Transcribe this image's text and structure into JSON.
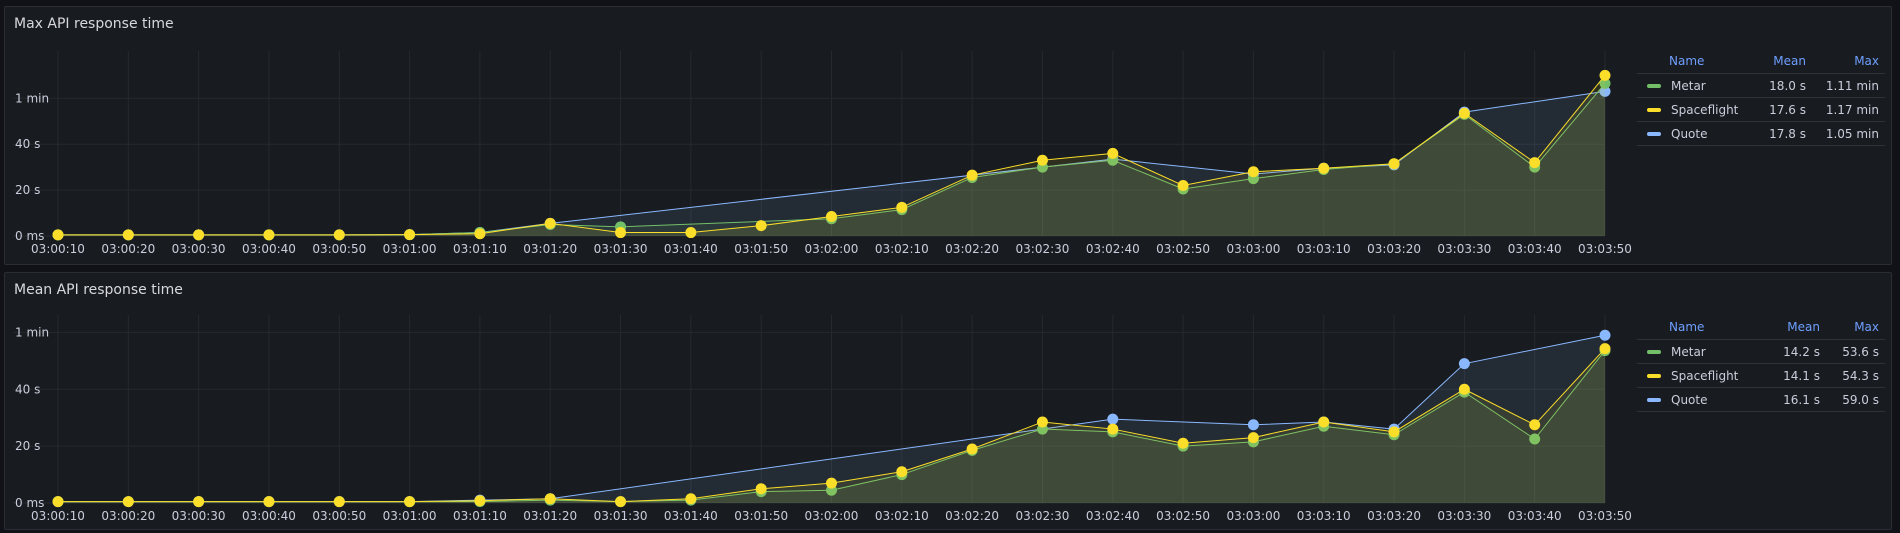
{
  "panels": [
    {
      "title": "Max API response time",
      "legend": {
        "headers": {
          "name": "Name",
          "mean": "Mean",
          "max": "Max"
        },
        "rows": [
          {
            "name": "Metar",
            "mean": "18.0 s",
            "max": "1.11 min",
            "color": "#73bf69"
          },
          {
            "name": "Spaceflight",
            "mean": "17.6 s",
            "max": "1.17 min",
            "color": "#fade2a"
          },
          {
            "name": "Quote",
            "mean": "17.8 s",
            "max": "1.05 min",
            "color": "#8ab8ff"
          }
        ]
      }
    },
    {
      "title": "Mean API response time",
      "legend": {
        "headers": {
          "name": "Name",
          "mean": "Mean",
          "max": "Max"
        },
        "rows": [
          {
            "name": "Metar",
            "mean": "14.2 s",
            "max": "53.6 s",
            "color": "#73bf69"
          },
          {
            "name": "Spaceflight",
            "mean": "14.1 s",
            "max": "54.3 s",
            "color": "#fade2a"
          },
          {
            "name": "Quote",
            "mean": "16.1 s",
            "max": "59.0 s",
            "color": "#8ab8ff"
          }
        ]
      }
    }
  ],
  "chart_data": [
    {
      "type": "line",
      "title": "Max API response time",
      "x_tick_labels": [
        "03:00:10",
        "03:00:20",
        "03:00:30",
        "03:00:40",
        "03:00:50",
        "03:01:00",
        "03:01:10",
        "03:01:20",
        "03:01:30",
        "03:01:40",
        "03:01:50",
        "03:02:00",
        "03:02:10",
        "03:02:20",
        "03:02:30",
        "03:02:40",
        "03:02:50",
        "03:03:00",
        "03:03:10",
        "03:03:20",
        "03:03:30",
        "03:03:40",
        "03:03:50"
      ],
      "y_ticks": [
        {
          "value": 0,
          "label": "0 ms"
        },
        {
          "value": 20,
          "label": "20 s"
        },
        {
          "value": 40,
          "label": "40 s"
        },
        {
          "value": 60,
          "label": "1 min"
        }
      ],
      "ylim": [
        0,
        78
      ],
      "y_unit": "seconds",
      "grid": true,
      "legend_position": "right",
      "series": [
        {
          "name": "Metar",
          "color": "#73bf69",
          "points": [
            [
              0,
              0.5
            ],
            [
              1,
              0.5
            ],
            [
              2,
              0.5
            ],
            [
              3,
              0.5
            ],
            [
              4,
              0.5
            ],
            [
              5,
              0.6
            ],
            [
              6,
              1.5
            ],
            [
              7,
              5
            ],
            [
              8,
              4
            ],
            [
              9,
              null
            ],
            [
              10,
              null
            ],
            [
              11,
              7.5
            ],
            [
              12,
              11.5
            ],
            [
              13,
              25.5
            ],
            [
              14,
              30
            ],
            [
              15,
              33
            ],
            [
              16,
              20.5
            ],
            [
              17,
              25
            ],
            [
              18,
              29
            ],
            [
              19,
              31.5
            ],
            [
              20,
              53
            ],
            [
              21,
              30
            ],
            [
              22,
              66.5
            ]
          ]
        },
        {
          "name": "Spaceflight",
          "color": "#fade2a",
          "points": [
            [
              0,
              0.5
            ],
            [
              1,
              0.5
            ],
            [
              2,
              0.5
            ],
            [
              3,
              0.5
            ],
            [
              4,
              0.5
            ],
            [
              5,
              0.6
            ],
            [
              6,
              1
            ],
            [
              7,
              5.5
            ],
            [
              8,
              1.5
            ],
            [
              9,
              1.5
            ],
            [
              10,
              4.5
            ],
            [
              11,
              8.5
            ],
            [
              12,
              12.5
            ],
            [
              13,
              26.5
            ],
            [
              14,
              33
            ],
            [
              15,
              36
            ],
            [
              16,
              22
            ],
            [
              17,
              28
            ],
            [
              18,
              29.5
            ],
            [
              19,
              31.5
            ],
            [
              20,
              53.5
            ],
            [
              21,
              32
            ],
            [
              22,
              70
            ]
          ]
        },
        {
          "name": "Quote",
          "color": "#8ab8ff",
          "points": [
            [
              0,
              0.5
            ],
            [
              1,
              0.5
            ],
            [
              2,
              0.5
            ],
            [
              3,
              0.5
            ],
            [
              4,
              0.5
            ],
            [
              5,
              0.6
            ],
            [
              6,
              1.5
            ],
            [
              7,
              5.5
            ],
            [
              8,
              null
            ],
            [
              9,
              null
            ],
            [
              10,
              null
            ],
            [
              11,
              null
            ],
            [
              12,
              null
            ],
            [
              13,
              null
            ],
            [
              14,
              null
            ],
            [
              15,
              33.5
            ],
            [
              16,
              null
            ],
            [
              17,
              27
            ],
            [
              18,
              29.5
            ],
            [
              19,
              31
            ],
            [
              20,
              54
            ],
            [
              21,
              null
            ],
            [
              22,
              63
            ]
          ]
        }
      ]
    },
    {
      "type": "line",
      "title": "Mean API response time",
      "x_tick_labels": [
        "03:00:10",
        "03:00:20",
        "03:00:30",
        "03:00:40",
        "03:00:50",
        "03:01:00",
        "03:01:10",
        "03:01:20",
        "03:01:30",
        "03:01:40",
        "03:01:50",
        "03:02:00",
        "03:02:10",
        "03:02:20",
        "03:02:30",
        "03:02:40",
        "03:02:50",
        "03:03:00",
        "03:03:10",
        "03:03:20",
        "03:03:30",
        "03:03:40",
        "03:03:50"
      ],
      "y_ticks": [
        {
          "value": 0,
          "label": "0 ms"
        },
        {
          "value": 20,
          "label": "20 s"
        },
        {
          "value": 40,
          "label": "40 s"
        },
        {
          "value": 60,
          "label": "1 min"
        }
      ],
      "ylim": [
        0,
        64
      ],
      "y_unit": "seconds",
      "grid": true,
      "legend_position": "right",
      "series": [
        {
          "name": "Metar",
          "color": "#73bf69",
          "points": [
            [
              0,
              0.5
            ],
            [
              1,
              0.5
            ],
            [
              2,
              0.5
            ],
            [
              3,
              0.5
            ],
            [
              4,
              0.5
            ],
            [
              5,
              0.5
            ],
            [
              6,
              0.5
            ],
            [
              7,
              1
            ],
            [
              8,
              0.5
            ],
            [
              9,
              1
            ],
            [
              10,
              4
            ],
            [
              11,
              4.5
            ],
            [
              12,
              10
            ],
            [
              13,
              18.5
            ],
            [
              14,
              26
            ],
            [
              15,
              25
            ],
            [
              16,
              20
            ],
            [
              17,
              21.5
            ],
            [
              18,
              27
            ],
            [
              19,
              24
            ],
            [
              20,
              39
            ],
            [
              21,
              22.5
            ],
            [
              22,
              53.6
            ]
          ]
        },
        {
          "name": "Spaceflight",
          "color": "#fade2a",
          "points": [
            [
              0,
              0.5
            ],
            [
              1,
              0.5
            ],
            [
              2,
              0.5
            ],
            [
              3,
              0.5
            ],
            [
              4,
              0.5
            ],
            [
              5,
              0.5
            ],
            [
              6,
              0.8
            ],
            [
              7,
              1.5
            ],
            [
              8,
              0.5
            ],
            [
              9,
              1.5
            ],
            [
              10,
              5
            ],
            [
              11,
              7
            ],
            [
              12,
              11
            ],
            [
              13,
              19
            ],
            [
              14,
              28.5
            ],
            [
              15,
              26
            ],
            [
              16,
              21
            ],
            [
              17,
              23
            ],
            [
              18,
              28.5
            ],
            [
              19,
              25
            ],
            [
              20,
              40
            ],
            [
              21,
              27.5
            ],
            [
              22,
              54.3
            ]
          ]
        },
        {
          "name": "Quote",
          "color": "#8ab8ff",
          "points": [
            [
              0,
              0.5
            ],
            [
              1,
              0.5
            ],
            [
              2,
              0.5
            ],
            [
              3,
              0.5
            ],
            [
              4,
              0.5
            ],
            [
              5,
              0.5
            ],
            [
              6,
              1
            ],
            [
              7,
              1.5
            ],
            [
              8,
              null
            ],
            [
              9,
              null
            ],
            [
              10,
              null
            ],
            [
              11,
              null
            ],
            [
              12,
              null
            ],
            [
              13,
              null
            ],
            [
              14,
              null
            ],
            [
              15,
              29.5
            ],
            [
              16,
              null
            ],
            [
              17,
              27.5
            ],
            [
              18,
              28.5
            ],
            [
              19,
              26
            ],
            [
              20,
              49
            ],
            [
              21,
              null
            ],
            [
              22,
              59
            ]
          ]
        }
      ]
    }
  ]
}
